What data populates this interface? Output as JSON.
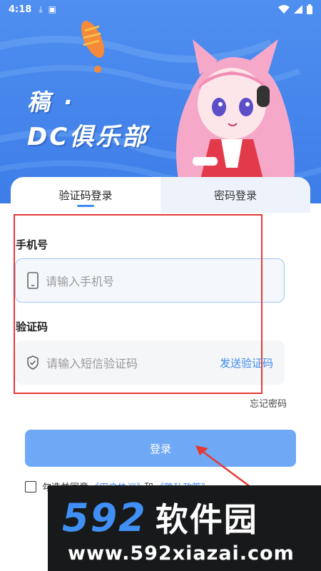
{
  "status_bar": {
    "time": "4:18"
  },
  "brand": {
    "line1": "稿 ·",
    "line2": "DC俱乐部"
  },
  "tabs": [
    {
      "label": "验证码登录",
      "active": true
    },
    {
      "label": "密码登录",
      "active": false
    }
  ],
  "phone": {
    "label": "手机号",
    "placeholder": "请输入手机号",
    "icon": "phone-icon"
  },
  "code": {
    "label": "验证码",
    "placeholder": "请输入短信验证码",
    "icon": "shield-icon",
    "send_label": "发送验证码"
  },
  "forgot_password": "忘记密码",
  "login_button": "登录",
  "agreement": {
    "prefix": "勾选并同意",
    "user_agreement": "《用户协议》",
    "and": "和",
    "privacy_policy": "《隐私政策》"
  },
  "watermark": {
    "number": "592",
    "name": "软件园",
    "url": "www.592xiazai.com"
  },
  "colors": {
    "accent": "#3d8af0",
    "header": "#4f8ff0",
    "highlight": "#e53935",
    "button": "#6fa9f5"
  }
}
